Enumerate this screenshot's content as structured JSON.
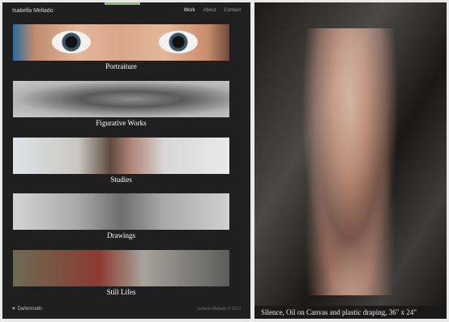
{
  "site": {
    "title": "Isabella Mellado",
    "nav": [
      "Work",
      "About",
      "Contact"
    ]
  },
  "categories": [
    {
      "label": "Portraiture"
    },
    {
      "label": "Figurative Works"
    },
    {
      "label": "Studies"
    },
    {
      "label": "Drawings"
    },
    {
      "label": "Still Lifes"
    }
  ],
  "footer": {
    "left": "Darkmoods",
    "right": "Isabella Mellado © 2013"
  },
  "artwork": {
    "caption": "Silence, Oil on Canvas and plastic draping, 36\" x 24\""
  },
  "colors": {
    "panel_bg": "#1f1f1f",
    "accent_tab": "#8bbf6a"
  }
}
